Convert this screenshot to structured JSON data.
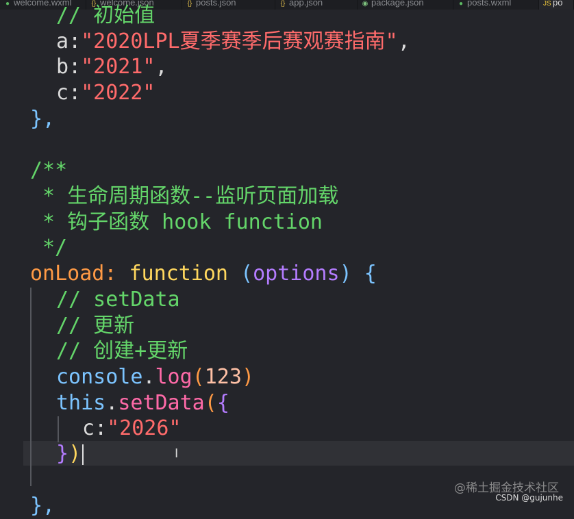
{
  "tabs": [
    {
      "label": "welcome.wxml",
      "icon": "wxml-file-icon",
      "active": false
    },
    {
      "label": "welcome.json",
      "icon": "json-file-icon",
      "active": false
    },
    {
      "label": "posts.json",
      "icon": "json-file-icon",
      "active": false
    },
    {
      "label": "app.json",
      "icon": "json-file-icon",
      "active": false
    },
    {
      "label": "package.json",
      "icon": "npm-file-icon",
      "active": false
    },
    {
      "label": "posts.wxml",
      "icon": "wxml-file-icon",
      "active": false
    },
    {
      "label": "po",
      "icon": "js-file-icon",
      "active": true
    }
  ],
  "code": {
    "line1_comment": "// 初始值",
    "a_key": "a",
    "a_value": "\"2020LPL夏季赛季后赛观赛指南\"",
    "b_key": "b",
    "b_value": "\"2021\"",
    "c_key": "c",
    "c_value": "\"2022\"",
    "close_brace": "},",
    "doc_open": "/**",
    "doc_line1": "* 生命周期函数--监听页面加载",
    "doc_line2": "* 钩子函数 hook function",
    "doc_close": "*/",
    "onload_name": "onLoad",
    "colon": ":",
    "function_kw": "function",
    "paren_open": "(",
    "options_param": "options",
    "paren_close": ")",
    "brace_open": "{",
    "comment_setdata": "// setData",
    "comment_update": "// 更新",
    "comment_create_update": "// 创建+更新",
    "console_obj": "console",
    "dot": ".",
    "log_method": "log",
    "log_paren_open": "(",
    "log_num": "123",
    "log_paren_close": ")",
    "this_kw": "this",
    "setdata_method": "setData",
    "setdata_paren_open": "(",
    "setdata_brace_open": "{",
    "c2_key": "c",
    "c2_value": "\"2026\"",
    "setdata_brace_close": "}",
    "setdata_paren_close": ")",
    "final_close": "},"
  },
  "watermark": "@稀土掘金技术社区",
  "credit": "CSDN @gujunhe"
}
